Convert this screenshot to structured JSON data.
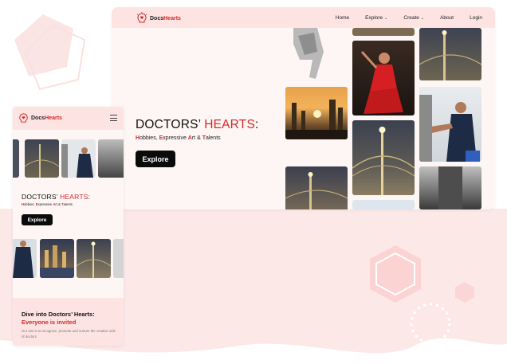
{
  "brand": {
    "prefix": "Docs",
    "suffix": "Hearts"
  },
  "desktop": {
    "nav": [
      {
        "label": "Home",
        "chevron": false
      },
      {
        "label": "Explore",
        "chevron": true
      },
      {
        "label": "Create",
        "chevron": true
      },
      {
        "label": "About",
        "chevron": false
      },
      {
        "label": "Login",
        "chevron": false
      }
    ],
    "hero": {
      "title_part1": "DOCTORS’ ",
      "title_part2": "HEARTS",
      "title_part3": ":",
      "subtitle": [
        {
          "first": "H",
          "rest": "obbies, "
        },
        {
          "first": "E",
          "rest": "xpressive "
        },
        {
          "first": "A",
          "rest": "rt & "
        },
        {
          "first": "T",
          "rest": "alents"
        }
      ],
      "button": "Explore"
    }
  },
  "mobile": {
    "hero": {
      "title_part1": "DOCTORS’ ",
      "title_part2": "HEARTS",
      "title_part3": ":",
      "button": "Explore"
    },
    "section": {
      "heading_line1": "Dive into Doctors’ Hearts:",
      "heading_line2": "Everyone is invited",
      "body": "Our aim is to recognize, promote and nurture the creative side of doctors"
    }
  },
  "icons": {
    "chevron": "chevron-down-icon",
    "menu": "hamburger-menu-icon",
    "logo": "bulb-heart-icon"
  },
  "colors": {
    "accent": "#d62828",
    "nav_bg": "#fde4e3",
    "page_bg": "#fdf6f5",
    "button": "#0b0b0b"
  }
}
